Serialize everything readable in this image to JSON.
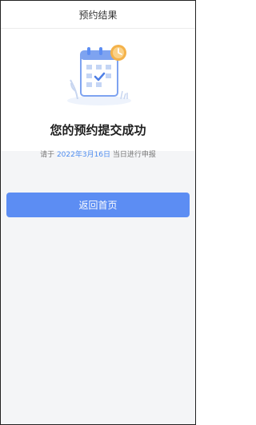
{
  "nav": {
    "title": "预约结果"
  },
  "result": {
    "title": "您的预约提交成功",
    "sub_prefix": "请于",
    "sub_date": "2022年3月16日",
    "sub_suffix": "当日进行申报",
    "illustration_icon": "calendar-check-clock-icon"
  },
  "actions": {
    "back_home_label": "返回首页"
  },
  "colors": {
    "primary": "#5c8df3",
    "date_highlight": "#4e8df0",
    "page_background": "#f4f5f7"
  }
}
